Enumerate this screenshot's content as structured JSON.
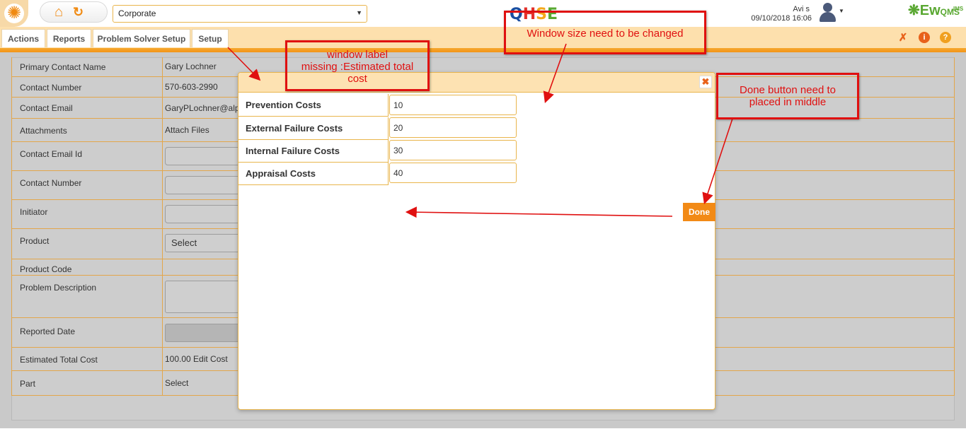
{
  "header": {
    "org_select_value": "Corporate",
    "logo_text": "QHSE",
    "user_name": "Avi s",
    "datetime": "09/10/2018 16:06",
    "brand_main": "Ew",
    "brand_sub": "QMS",
    "brand_sup": "IMS"
  },
  "menu": {
    "items": [
      "Actions",
      "Reports",
      "Problem Solver Setup",
      "Setup"
    ]
  },
  "form": {
    "rows": [
      {
        "label": "Primary Contact Name",
        "value": "Gary Lochner"
      },
      {
        "label": "Contact Number",
        "value": "570-603-2990"
      },
      {
        "label": "Contact Email",
        "value": "GaryPLochner@alp"
      },
      {
        "label": "Attachments",
        "value": "Attach Files"
      },
      {
        "label": "Contact Email Id",
        "value": ""
      },
      {
        "label": "Contact Number",
        "value": ""
      },
      {
        "label": "Initiator",
        "value": ""
      },
      {
        "label": "Product",
        "value": "Select"
      },
      {
        "label": "Product Code",
        "value": ""
      },
      {
        "label": "Problem Description",
        "value": ""
      },
      {
        "label": "Reported Date",
        "value": ""
      },
      {
        "label": "Estimated Total Cost",
        "value": "100.00 Edit Cost"
      },
      {
        "label": "Part",
        "value": "Select"
      }
    ]
  },
  "modal": {
    "title": "",
    "close_symbol": "✖",
    "costs": [
      {
        "label": "Prevention Costs",
        "value": "10"
      },
      {
        "label": "External Failure Costs",
        "value": "20"
      },
      {
        "label": "Internal Failure Costs",
        "value": "30"
      },
      {
        "label": "Appraisal Costs",
        "value": "40"
      }
    ],
    "done_label": "Done"
  },
  "annotations": {
    "label_missing": "window label\nmissing :Estimated total\ncost",
    "window_size": "Window size need to be changed",
    "done_button": "Done button need to\nplaced in middle"
  },
  "colors": {
    "accent": "#f28a16",
    "annotation": "#e01010",
    "header_bg": "#fde0ad"
  },
  "icons": {
    "home": "home-icon",
    "refresh": "refresh-icon",
    "pin": "pin-icon",
    "info": "info-icon",
    "help": "help-icon",
    "close": "close-icon"
  }
}
